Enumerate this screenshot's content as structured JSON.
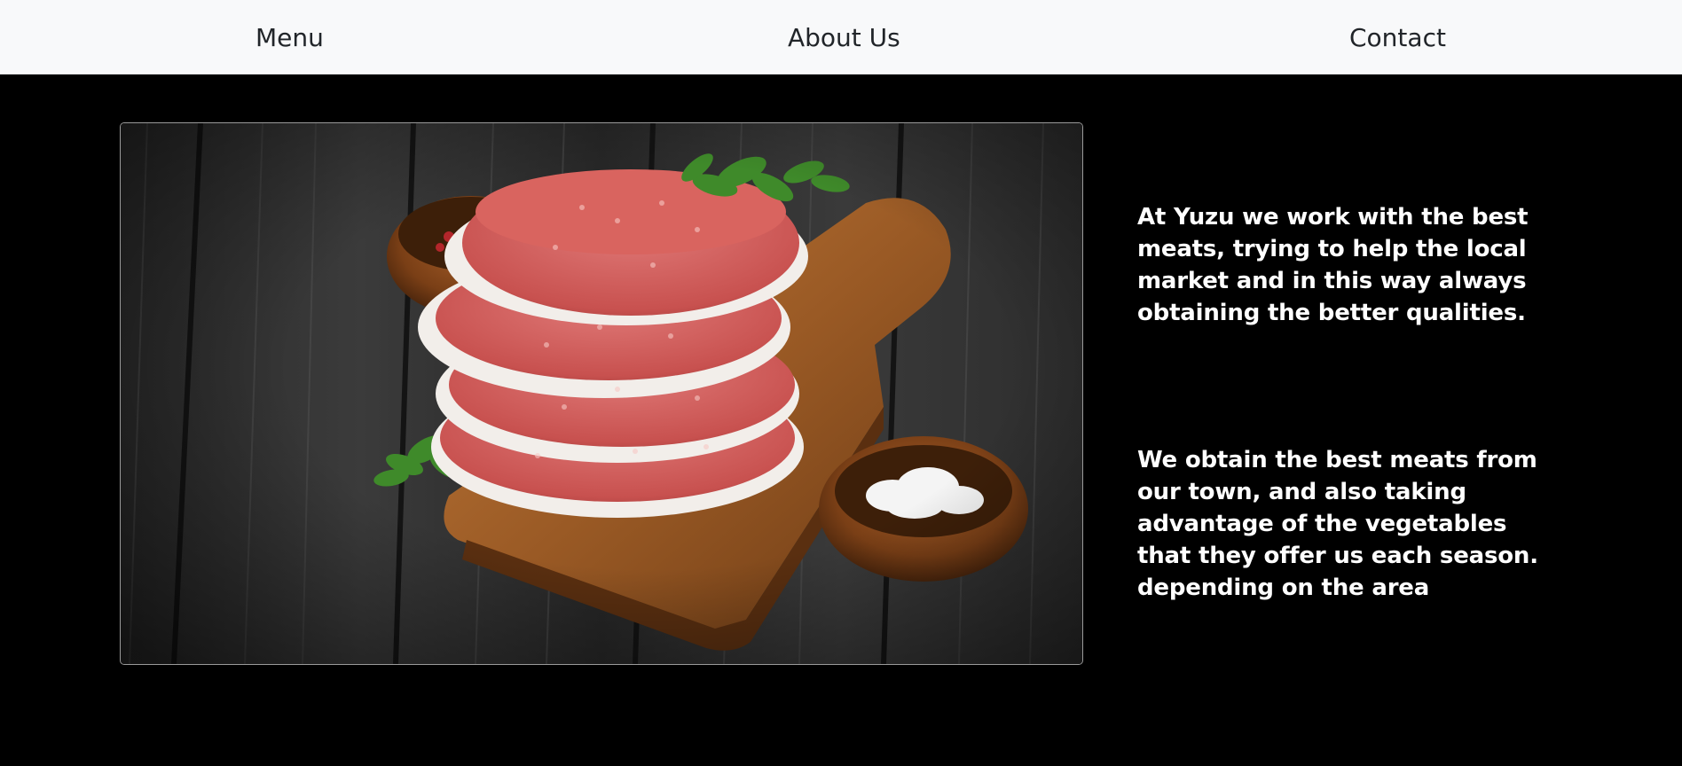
{
  "nav": {
    "items": [
      {
        "label": "Menu"
      },
      {
        "label": "About Us"
      },
      {
        "label": "Contact"
      }
    ]
  },
  "about": {
    "image_icon": "burger-patties-photo",
    "paragraph_1": "At Yuzu we work with the best meats, trying to help the local market and in this way always obtaining the better qualities.",
    "paragraph_2": "We obtain the best meats from our town, and also taking advantage of the vegetables that they offer us each season. depending on the area"
  },
  "colors": {
    "navbar_bg": "#f8f9fa",
    "nav_text": "#212529",
    "page_bg": "#000000",
    "body_text": "#ffffff"
  }
}
